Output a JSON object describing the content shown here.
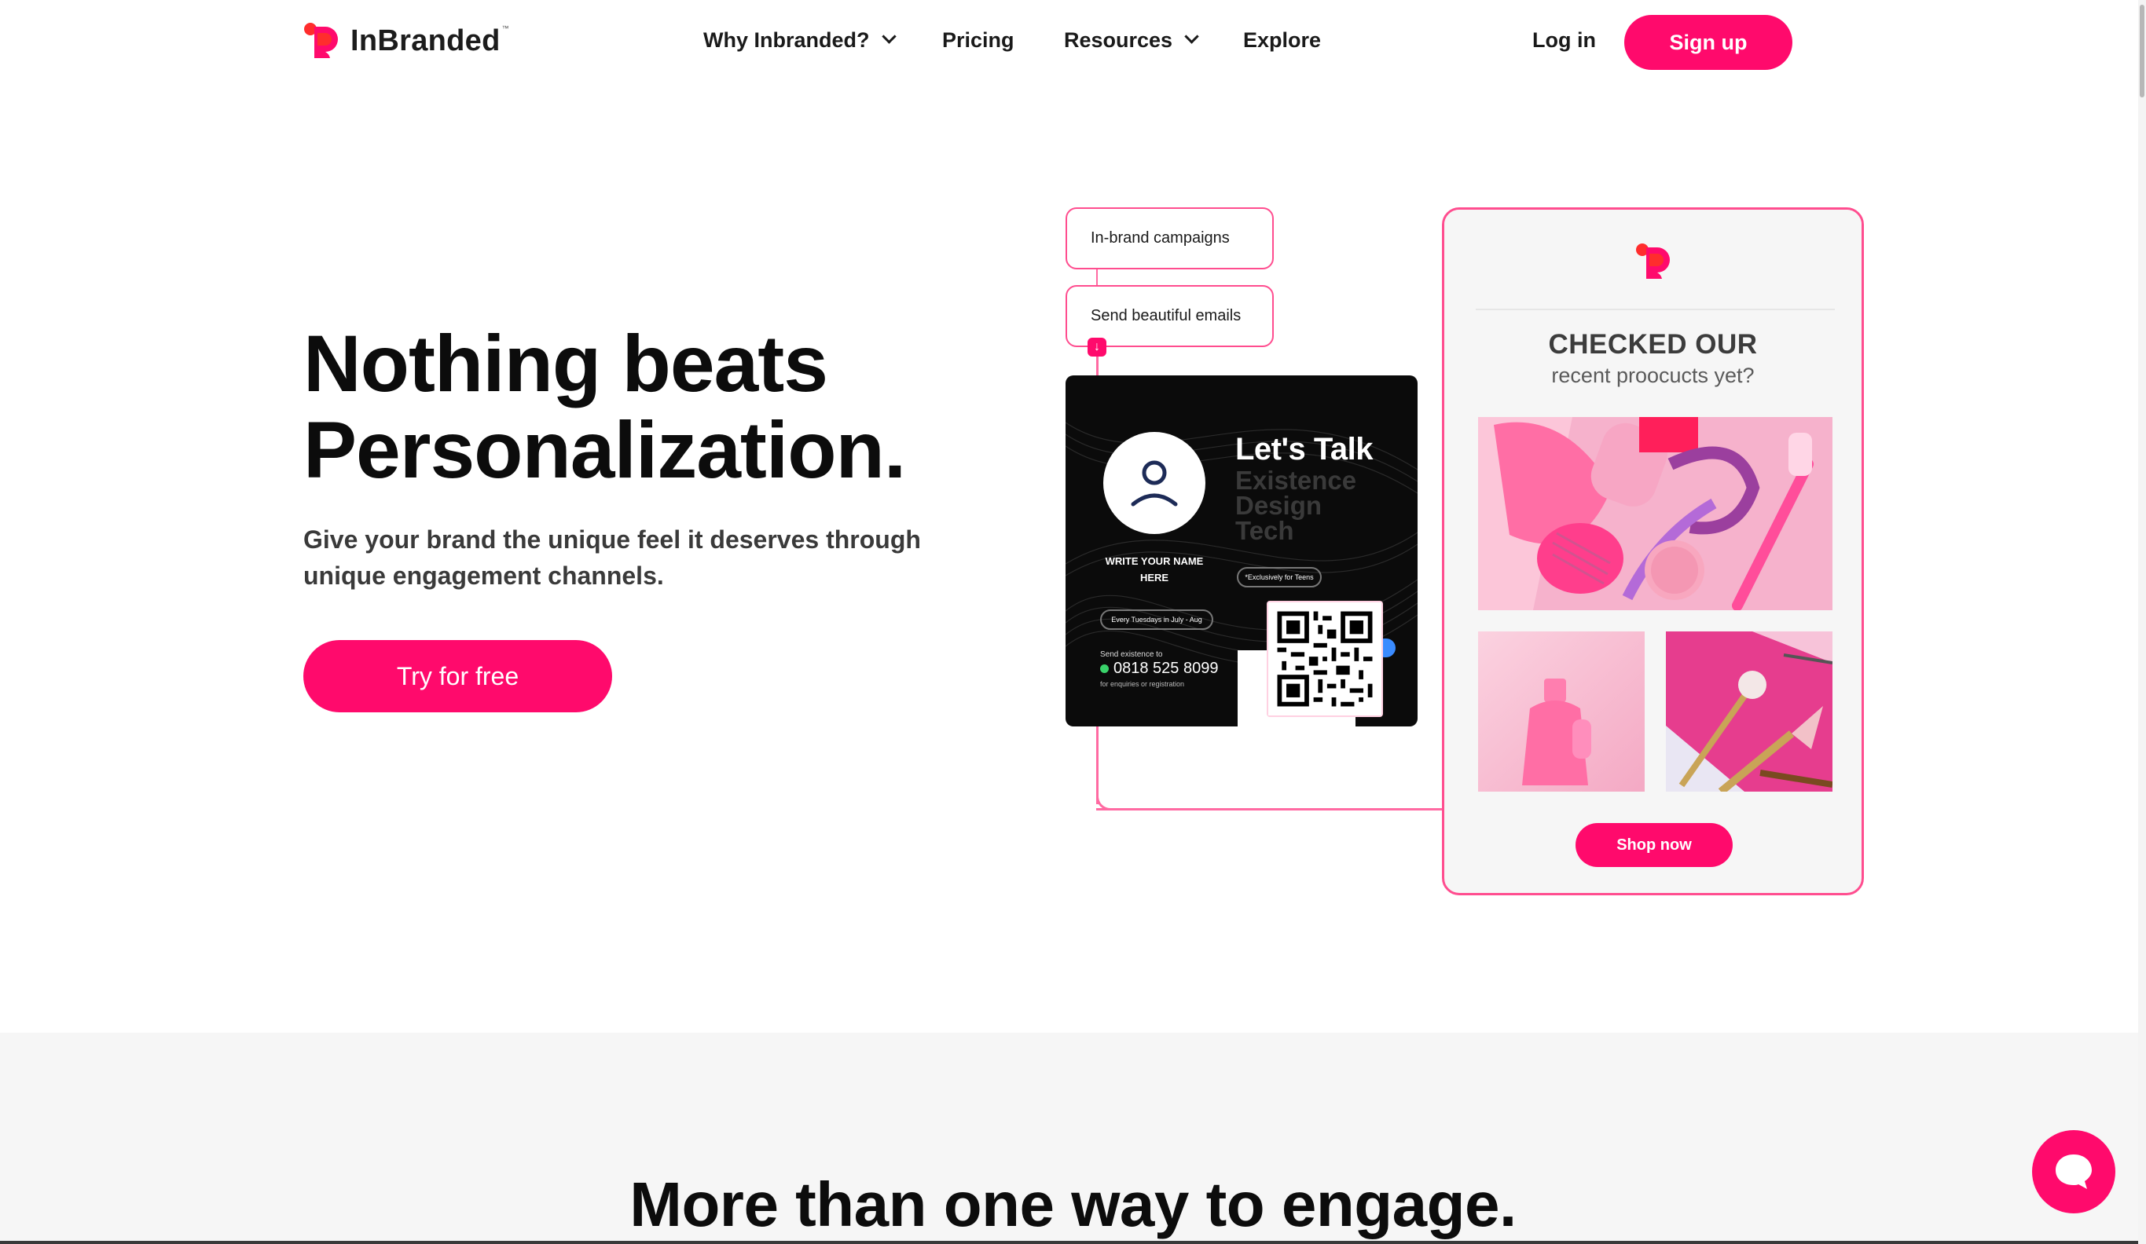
{
  "colors": {
    "brand": "#ff0a6c",
    "text": "#0c0c0c",
    "muted": "#3a3a3a",
    "section_bg": "#f6f6f6"
  },
  "header": {
    "logo_text": "InBranded",
    "logo_tm": "™",
    "nav": [
      {
        "label": "Why Inbranded?",
        "has_dropdown": true
      },
      {
        "label": "Pricing",
        "has_dropdown": false
      },
      {
        "label": "Resources",
        "has_dropdown": true
      },
      {
        "label": "Explore",
        "has_dropdown": false
      }
    ],
    "login_label": "Log in",
    "signup_label": "Sign up"
  },
  "hero": {
    "title_line1": "Nothing beats",
    "title_line2": "Personalization.",
    "subtitle": "Give your brand the unique feel it deserves through unique engagement channels.",
    "cta_label": "Try for free"
  },
  "illustration": {
    "tags": [
      "In-brand campaigns",
      "Send beautiful emails"
    ],
    "flyer": {
      "avatar_label": "WRITE YOUR NAME HERE",
      "heading": "Let's Talk",
      "brand_lines": [
        "Existence",
        "Design",
        "Tech"
      ],
      "badge": "*Exclusively for Teens",
      "schedule": "Every Tuesdays in July - Aug",
      "send_text": "Send existence to",
      "phone": "0818 525 8099",
      "enquiries": "for enquiries or registration"
    },
    "email_panel": {
      "heading": "CHECKED OUR",
      "subheading": "recent proocucts yet?",
      "shop_label": "Shop now"
    }
  },
  "section2": {
    "title": "More than one way to engage."
  },
  "icons": [
    "logo-icon",
    "chevron-down-icon",
    "user-icon",
    "qr-code-icon",
    "whatsapp-icon",
    "chat-icon",
    "arrow-down-icon"
  ]
}
